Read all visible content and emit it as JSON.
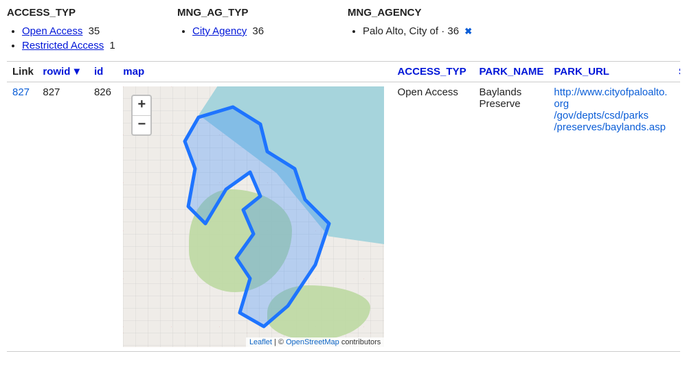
{
  "facets": {
    "access_typ": {
      "title": "ACCESS_TYP",
      "items": [
        {
          "label": "Open Access",
          "count": "35",
          "linked": true
        },
        {
          "label": "Restricted Access",
          "count": "1",
          "linked": true
        }
      ]
    },
    "mng_ag_typ": {
      "title": "MNG_AG_TYP",
      "items": [
        {
          "label": "City Agency",
          "count": "36",
          "linked": true
        }
      ]
    },
    "mng_agency": {
      "title": "MNG_AGENCY",
      "items": [
        {
          "label": "Palo Alto, City of · 36",
          "linked": false,
          "removable": true
        }
      ]
    }
  },
  "columns": {
    "link": {
      "label": "Link",
      "sortable": false
    },
    "rowid": {
      "label": "rowid",
      "sortable": true,
      "sorted": "desc",
      "indicator": "▼"
    },
    "id": {
      "label": "id",
      "sortable": true
    },
    "map": {
      "label": "map",
      "sortable": true
    },
    "access_typ": {
      "label": "ACCESS_TYP",
      "sortable": true
    },
    "park_name": {
      "label": "PARK_NAME",
      "sortable": true
    },
    "park_url": {
      "label": "PARK_URL",
      "sortable": true
    }
  },
  "row": {
    "link": "827",
    "rowid": "827",
    "id": "826",
    "access_typ": "Open Access",
    "park_name": "Baylands Preserve",
    "park_url_line1": "http://www.cityofpaloalto.org",
    "park_url_line2": "/gov/depts/csd/parks",
    "park_url_line3": "/preserves/baylands.asp"
  },
  "map": {
    "zoom_in": "+",
    "zoom_out": "−",
    "attr_leaflet": "Leaflet",
    "attr_sep": " | © ",
    "attr_osm": "OpenStreetMap",
    "attr_tail": " contributors"
  },
  "icons": {
    "remove": "✖"
  }
}
